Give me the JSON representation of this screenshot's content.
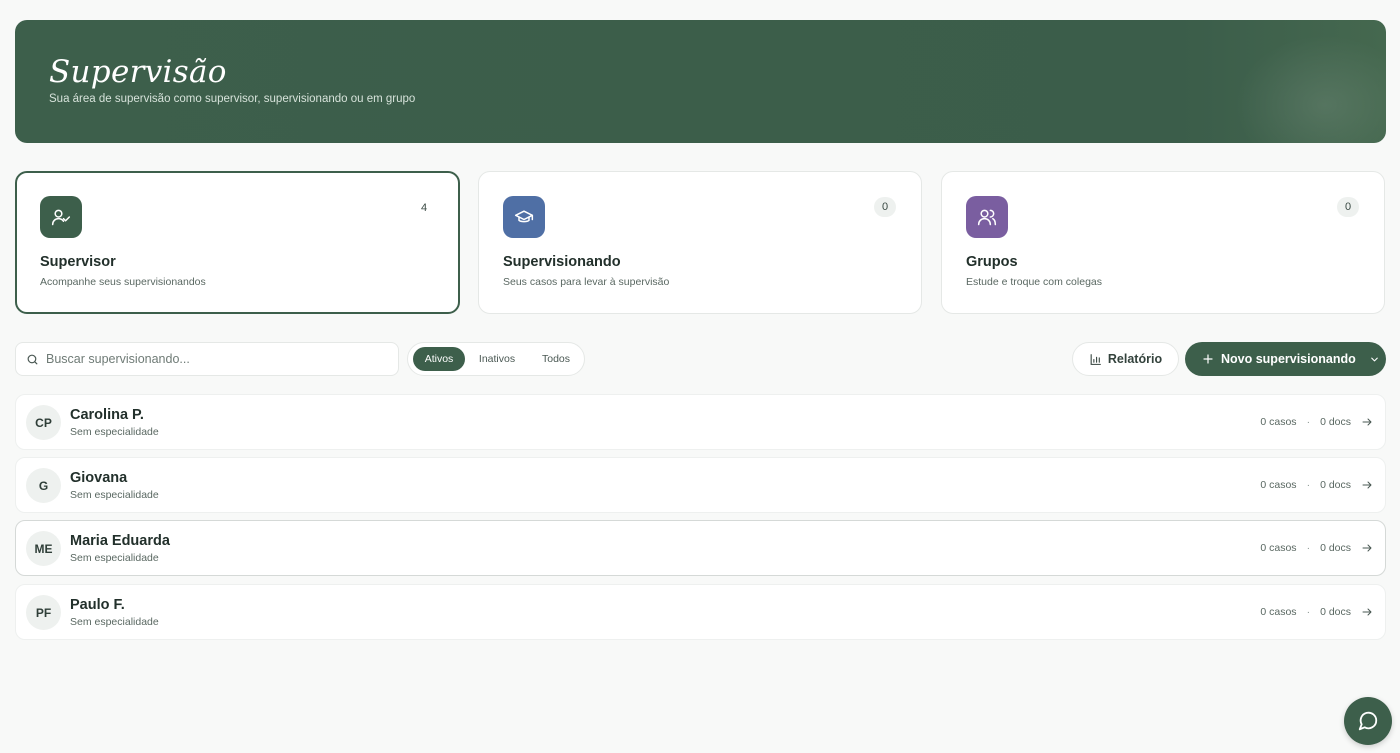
{
  "hero": {
    "title": "Supervisão",
    "subtitle": "Sua área de supervisão como supervisor, supervisionando ou em grupo"
  },
  "cards": [
    {
      "title": "Supervisor",
      "subtitle": "Acompanhe seus supervisionandos",
      "count": "4",
      "icon": "user-check-icon",
      "color": "#3d5f4b"
    },
    {
      "title": "Supervisionando",
      "subtitle": "Seus casos para levar à supervisão",
      "count": "0",
      "icon": "graduation-cap-icon",
      "color": "#4f6fa5"
    },
    {
      "title": "Grupos",
      "subtitle": "Estude e troque com colegas",
      "count": "0",
      "icon": "users-icon",
      "color": "#7a5ea0"
    }
  ],
  "search": {
    "placeholder": "Buscar supervisionando..."
  },
  "filters": {
    "active": "Ativos",
    "inactive": "Inativos",
    "all": "Todos"
  },
  "actions": {
    "report": "Relatório",
    "new": "Novo supervisionando"
  },
  "rows": [
    {
      "initials": "CP",
      "name": "Carolina P.",
      "specialty": "Sem especialidade",
      "cases": "0 casos",
      "docs": "0 docs"
    },
    {
      "initials": "G",
      "name": "Giovana",
      "specialty": "Sem especialidade",
      "cases": "0 casos",
      "docs": "0 docs"
    },
    {
      "initials": "ME",
      "name": "Maria Eduarda",
      "specialty": "Sem especialidade",
      "cases": "0 casos",
      "docs": "0 docs"
    },
    {
      "initials": "PF",
      "name": "Paulo F.",
      "specialty": "Sem especialidade",
      "cases": "0 casos",
      "docs": "0 docs"
    }
  ],
  "colors": {
    "brand": "#3d5f4b",
    "supervisionando": "#4f6fa5",
    "grupos": "#7a5ea0"
  }
}
